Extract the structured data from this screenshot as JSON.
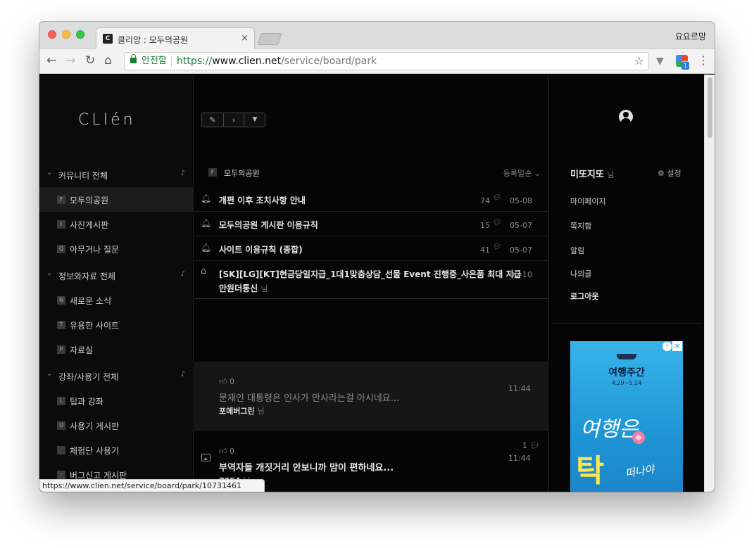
{
  "browser": {
    "tab_title": "클리앙 : 모두의공원",
    "tab_favicon": "C",
    "tab_close": "×",
    "profile_name": "요요르망",
    "secure_label": "안전함",
    "url_scheme": "https://",
    "url_host": "www.clien.net",
    "url_path": "/service/board/park",
    "status_url": "https://www.clien.net/service/board/park/10731461",
    "ext_badge": "1"
  },
  "sidebar": {
    "logo": "CLIén",
    "groups": [
      {
        "label": "커뮤니티 전체",
        "items": [
          {
            "badge": "F",
            "label": "모두의공원"
          },
          {
            "badge": "I",
            "label": "사진게시판"
          },
          {
            "badge": "Q",
            "label": "아무거나 질문"
          }
        ]
      },
      {
        "label": "정보와자료 전체",
        "items": [
          {
            "badge": "N",
            "label": "새로운 소식"
          },
          {
            "badge": "T",
            "label": "유용한 사이트"
          },
          {
            "badge": "P",
            "label": "자료실"
          }
        ]
      },
      {
        "label": "강좌/사용기 전체",
        "items": [
          {
            "badge": "L",
            "label": "팁과 강좌"
          },
          {
            "badge": "U",
            "label": "사용기 게시판"
          },
          {
            "badge": "·",
            "label": "체험단 사용기"
          },
          {
            "badge": "·",
            "label": "버그신고 게시판"
          }
        ]
      }
    ]
  },
  "board": {
    "badge": "F",
    "name": "모두의공원",
    "sort_label": "등록일순",
    "notices": [
      {
        "title": "개편 이후 조치사항 안내",
        "comments": "74",
        "date": "05-08"
      },
      {
        "title": "모두의공원 게시판 이용규칙",
        "comments": "15",
        "date": "05-07"
      },
      {
        "title": "사이트 이용규칙 (종합)",
        "comments": "41",
        "date": "05-07"
      }
    ],
    "ad_post": {
      "title": "[SK][LG][KT]현금당일지급_1대1맞춤상담_선물 Event 진행중_사은품 최대 지급",
      "author": "만원더통신",
      "date": "05-10"
    },
    "posts": [
      {
        "likes": "0",
        "title": "문재인 대통령은 인사가 만사라는걸 아시네요...",
        "author": "포에버그린",
        "time": "11:44",
        "comments": ""
      },
      {
        "likes": "0",
        "title": "부역자들 개짓거리 안보니까 맘이 편하네요...",
        "author": "7254",
        "time": "11:44",
        "comments": "1"
      }
    ],
    "nim": "님"
  },
  "user": {
    "name": "미또지또",
    "settings_label": "설정",
    "menu": [
      "마이페이지",
      "쪽지함",
      "알림",
      "나의글",
      "로그아웃"
    ]
  },
  "ad": {
    "title": "여행주간",
    "date_range": "4.29~5.14",
    "brush1": "여행은",
    "brush2": "탁",
    "brush3": "떠나야",
    "adchoice": "i",
    "close": "×"
  },
  "icons": {
    "back": "back-arrow-icon",
    "forward": "forward-arrow-icon",
    "reload": "reload-icon",
    "home": "home-icon",
    "star": "star-icon",
    "bell": "bell-icon",
    "comment": "comment-bubble-icon",
    "thumb": "thumbs-up-icon",
    "gear": "gear-icon"
  },
  "colors": {
    "secure_green": "#188038",
    "page_bg": "#000000",
    "ad_blue": "#2aa5e0"
  }
}
